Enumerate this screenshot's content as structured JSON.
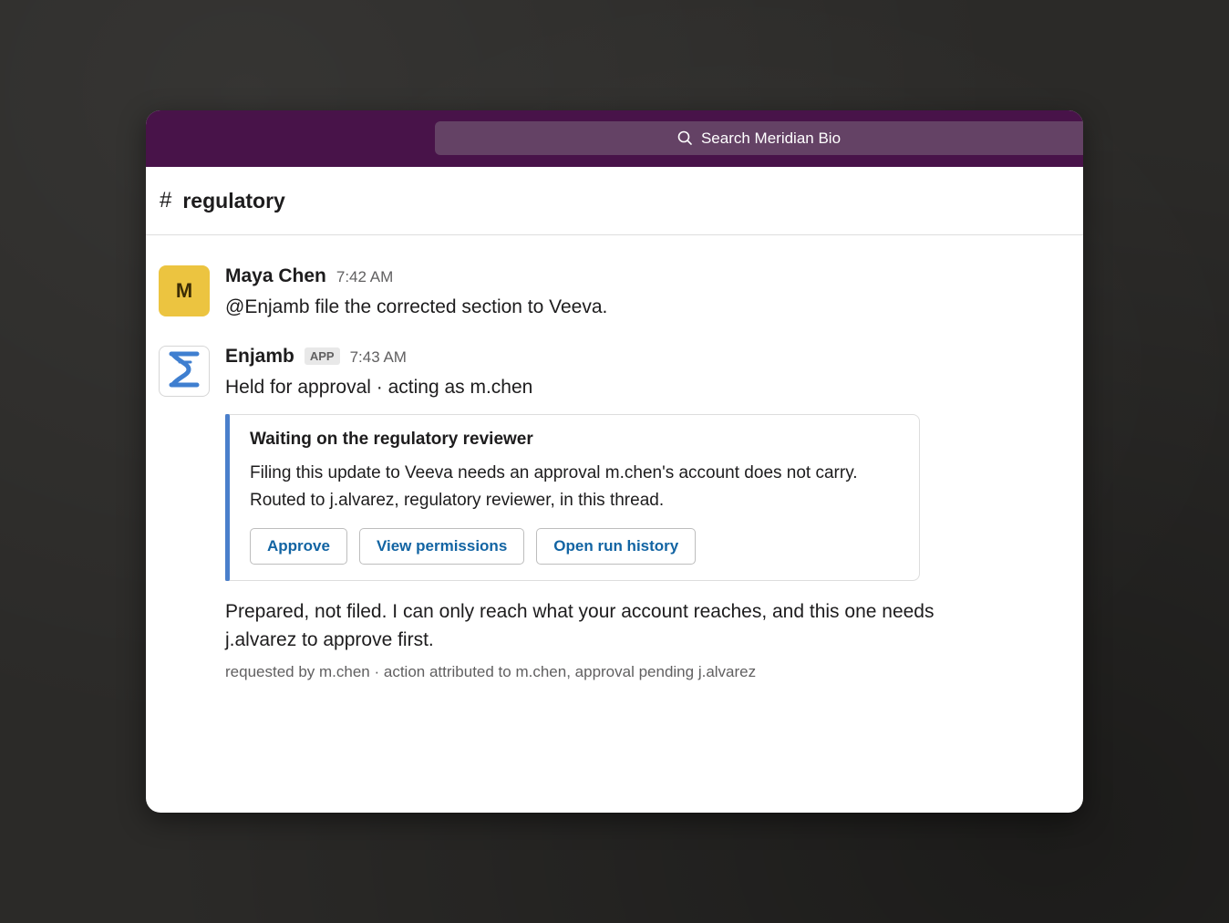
{
  "search": {
    "placeholder": "Search Meridian Bio"
  },
  "channel": {
    "hash": "#",
    "name": "regulatory"
  },
  "messages": [
    {
      "avatar_letter": "M",
      "author": "Maya Chen",
      "time": "7:42 AM",
      "text": "@Enjamb file the corrected section to Veeva."
    },
    {
      "author": "Enjamb",
      "badge": "APP",
      "time": "7:43 AM",
      "text": "Held for approval · acting as m.chen",
      "card": {
        "title": "Waiting on the regulatory reviewer",
        "body": "Filing this update to Veeva needs an approval m.chen's account does not carry. Routed to j.alvarez, regulatory reviewer, in this thread.",
        "buttons": [
          "Approve",
          "View permissions",
          "Open run history"
        ]
      },
      "follow_text": "Prepared, not filed. I can only reach what your account reaches, and this one needs j.alvarez to approve first.",
      "footnote": "requested by m.chen · action attributed to m.chen, approval pending j.alvarez"
    }
  ],
  "colors": {
    "topbar": "#481349",
    "search_bg": "#644265",
    "avatar_maya": "#ecc440",
    "card_accent": "#4a7fcb",
    "button_text": "#1264a3",
    "enjamb_logo": "#3f7fd0"
  }
}
